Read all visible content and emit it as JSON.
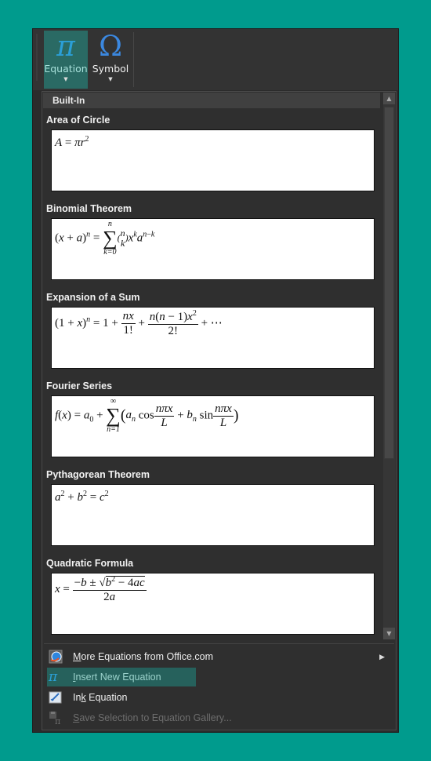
{
  "ribbon": {
    "equation_button": {
      "label": "Equation",
      "glyph": "π",
      "icon": "pi-icon"
    },
    "symbol_button": {
      "label": "Symbol",
      "glyph": "Ω",
      "icon": "omega-icon"
    }
  },
  "gallery": {
    "header": "Built-In",
    "items": [
      {
        "title": "Area of Circle",
        "equation": "A = πr²"
      },
      {
        "title": "Binomial Theorem",
        "equation": "(x + a)ⁿ = Σ_{k=0}^{n} (n choose k) xᵏ aⁿ⁻ᵏ"
      },
      {
        "title": "Expansion of a Sum",
        "equation": "(1 + x)ⁿ = 1 + nx/1! + n(n − 1)x²/2! + ⋯"
      },
      {
        "title": "Fourier Series",
        "equation": "f(x) = a₀ + Σ_{n=1}^{∞} (aₙ cos nπx/L + bₙ sin nπx/L)"
      },
      {
        "title": "Pythagorean Theorem",
        "equation": "a² + b² = c²"
      },
      {
        "title": "Quadratic Formula",
        "equation": "x = (−b ± √(b² − 4ac)) / 2a"
      }
    ],
    "scroll_position": 0.0
  },
  "menu": {
    "items": [
      {
        "label": "More Equations from Office.com",
        "accel": "M",
        "icon": "office-globe-icon",
        "has_submenu": true,
        "enabled": true,
        "highlighted": false
      },
      {
        "label": "Insert New Equation",
        "accel": "I",
        "icon": "pi-icon",
        "has_submenu": false,
        "enabled": true,
        "highlighted": true
      },
      {
        "label": "Ink Equation",
        "accel": "k",
        "icon": "ink-pen-icon",
        "has_submenu": false,
        "enabled": true,
        "highlighted": false
      },
      {
        "label": "Save Selection to Equation Gallery...",
        "accel": "S",
        "icon": "save-equation-icon",
        "has_submenu": false,
        "enabled": false,
        "highlighted": false
      }
    ]
  },
  "colors": {
    "background": "#009b8d",
    "panel": "#2f2f2f",
    "highlight": "#26615c",
    "accent_blue": "#2e86de"
  }
}
